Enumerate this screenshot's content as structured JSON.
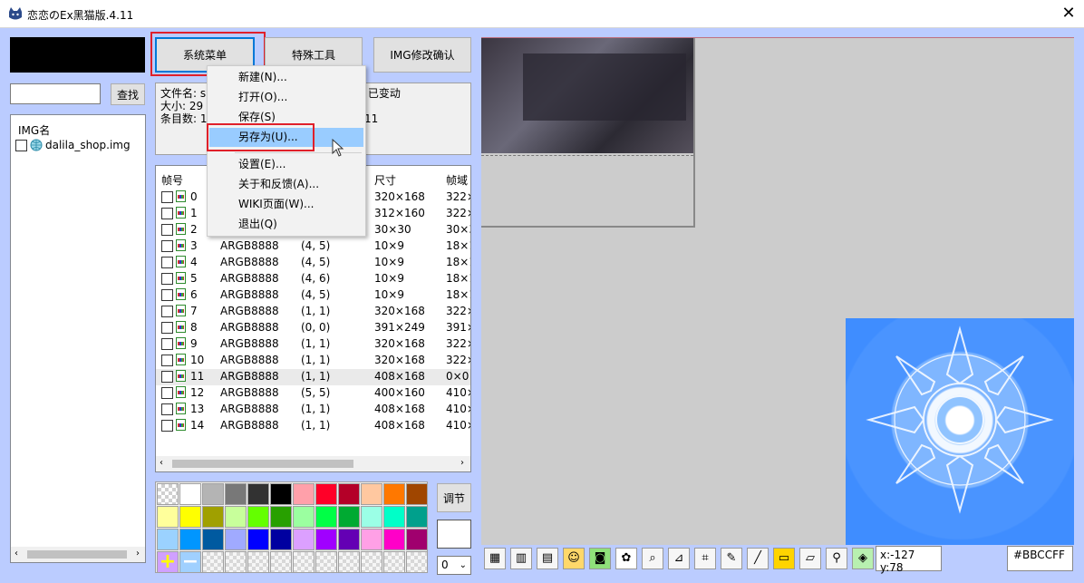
{
  "window": {
    "title": "恋恋のEx黑猫版.4.11",
    "close_glyph": "✕"
  },
  "left": {
    "search": {
      "value": "",
      "placeholder": ""
    },
    "find_label": "查找",
    "img_list": {
      "header": "IMG名",
      "items": [
        "dalila_shop.img"
      ]
    }
  },
  "top_buttons": {
    "system_menu": "系统菜单",
    "special_tools": "特殊工具",
    "img_confirm": "IMG修改确认"
  },
  "info": {
    "filename_label": "文件名: s",
    "status": ": 已变动",
    "size_label": "大小: 29",
    "entries_label": "条目数: 1",
    "entries_tail": "11"
  },
  "frame_table": {
    "headers": {
      "frame": "帧号",
      "size": "尺寸",
      "domain": "帧域"
    },
    "rows": [
      {
        "id": "0",
        "fmt": "",
        "pos": "",
        "size": "320×168",
        "domain": "322×"
      },
      {
        "id": "1",
        "fmt": "",
        "pos": "",
        "size": "312×160",
        "domain": "322×"
      },
      {
        "id": "2",
        "fmt": "",
        "pos": "",
        "size": "30×30",
        "domain": "30×3"
      },
      {
        "id": "3",
        "fmt": "ARGB8888",
        "pos": "(4, 5)",
        "size": "10×9",
        "domain": "18×1"
      },
      {
        "id": "4",
        "fmt": "ARGB8888",
        "pos": "(4, 5)",
        "size": "10×9",
        "domain": "18×1"
      },
      {
        "id": "5",
        "fmt": "ARGB8888",
        "pos": "(4, 6)",
        "size": "10×9",
        "domain": "18×1"
      },
      {
        "id": "6",
        "fmt": "ARGB8888",
        "pos": "(4, 5)",
        "size": "10×9",
        "domain": "18×1"
      },
      {
        "id": "7",
        "fmt": "ARGB8888",
        "pos": "(1, 1)",
        "size": "320×168",
        "domain": "322×"
      },
      {
        "id": "8",
        "fmt": "ARGB8888",
        "pos": "(0, 0)",
        "size": "391×249",
        "domain": "391×"
      },
      {
        "id": "9",
        "fmt": "ARGB8888",
        "pos": "(1, 1)",
        "size": "320×168",
        "domain": "322×"
      },
      {
        "id": "10",
        "fmt": "ARGB8888",
        "pos": "(1, 1)",
        "size": "320×168",
        "domain": "322×"
      },
      {
        "id": "11",
        "fmt": "ARGB8888",
        "pos": "(1, 1)",
        "size": "408×168",
        "domain": "0×0"
      },
      {
        "id": "12",
        "fmt": "ARGB8888",
        "pos": "(5, 5)",
        "size": "400×160",
        "domain": "410×"
      },
      {
        "id": "13",
        "fmt": "ARGB8888",
        "pos": "(1, 1)",
        "size": "408×168",
        "domain": "410×"
      },
      {
        "id": "14",
        "fmt": "ARGB8888",
        "pos": "(1, 1)",
        "size": "408×168",
        "domain": "410×"
      }
    ],
    "selected_row": "11"
  },
  "menu": {
    "items": [
      "新建(N)...",
      "打开(O)...",
      "保存(S)",
      "另存为(U)...",
      "设置(E)...",
      "关于和反馈(A)...",
      "WIKI页面(W)...",
      "退出(Q)"
    ],
    "hovered": "另存为(U)..."
  },
  "palette": {
    "colors": [
      "checker",
      "#ffffff",
      "#b4b4b4",
      "#787878",
      "#323232",
      "#000000",
      "#ffa0aa",
      "#ff0028",
      "#b40028",
      "#ffc8a0",
      "#ff7800",
      "#a04600",
      "#ffff9b",
      "#ffff00",
      "#a0a000",
      "#c8ff9b",
      "#64ff00",
      "#28a000",
      "#9bffa0",
      "#00ff46",
      "#00aa32",
      "#9bffe6",
      "#00ffc8",
      "#00a08c",
      "#9bd2ff",
      "#0096ff",
      "#005aa0",
      "#a0aaff",
      "#0000ff",
      "#0000a0",
      "#dca0ff",
      "#a000ff",
      "#6400b4",
      "#ffa0e6",
      "#ff00c8",
      "#a0006e"
    ],
    "plus_glyph": "+",
    "minus_glyph": "−",
    "adjust_label": "调节",
    "layer_value": "0"
  },
  "toolbar": {
    "tools": [
      "canvas-icon",
      "palette-icon",
      "film-icon",
      "cat-icon",
      "camera-icon",
      "paw-icon",
      "magnifier-icon",
      "align-icon",
      "crop-icon",
      "pencil-icon",
      "line-icon",
      "rectangle-icon",
      "eraser-icon",
      "eyedropper-icon",
      "tag-icon"
    ],
    "coord": "x:-127 y:78",
    "hex": "#BBCCFF"
  }
}
